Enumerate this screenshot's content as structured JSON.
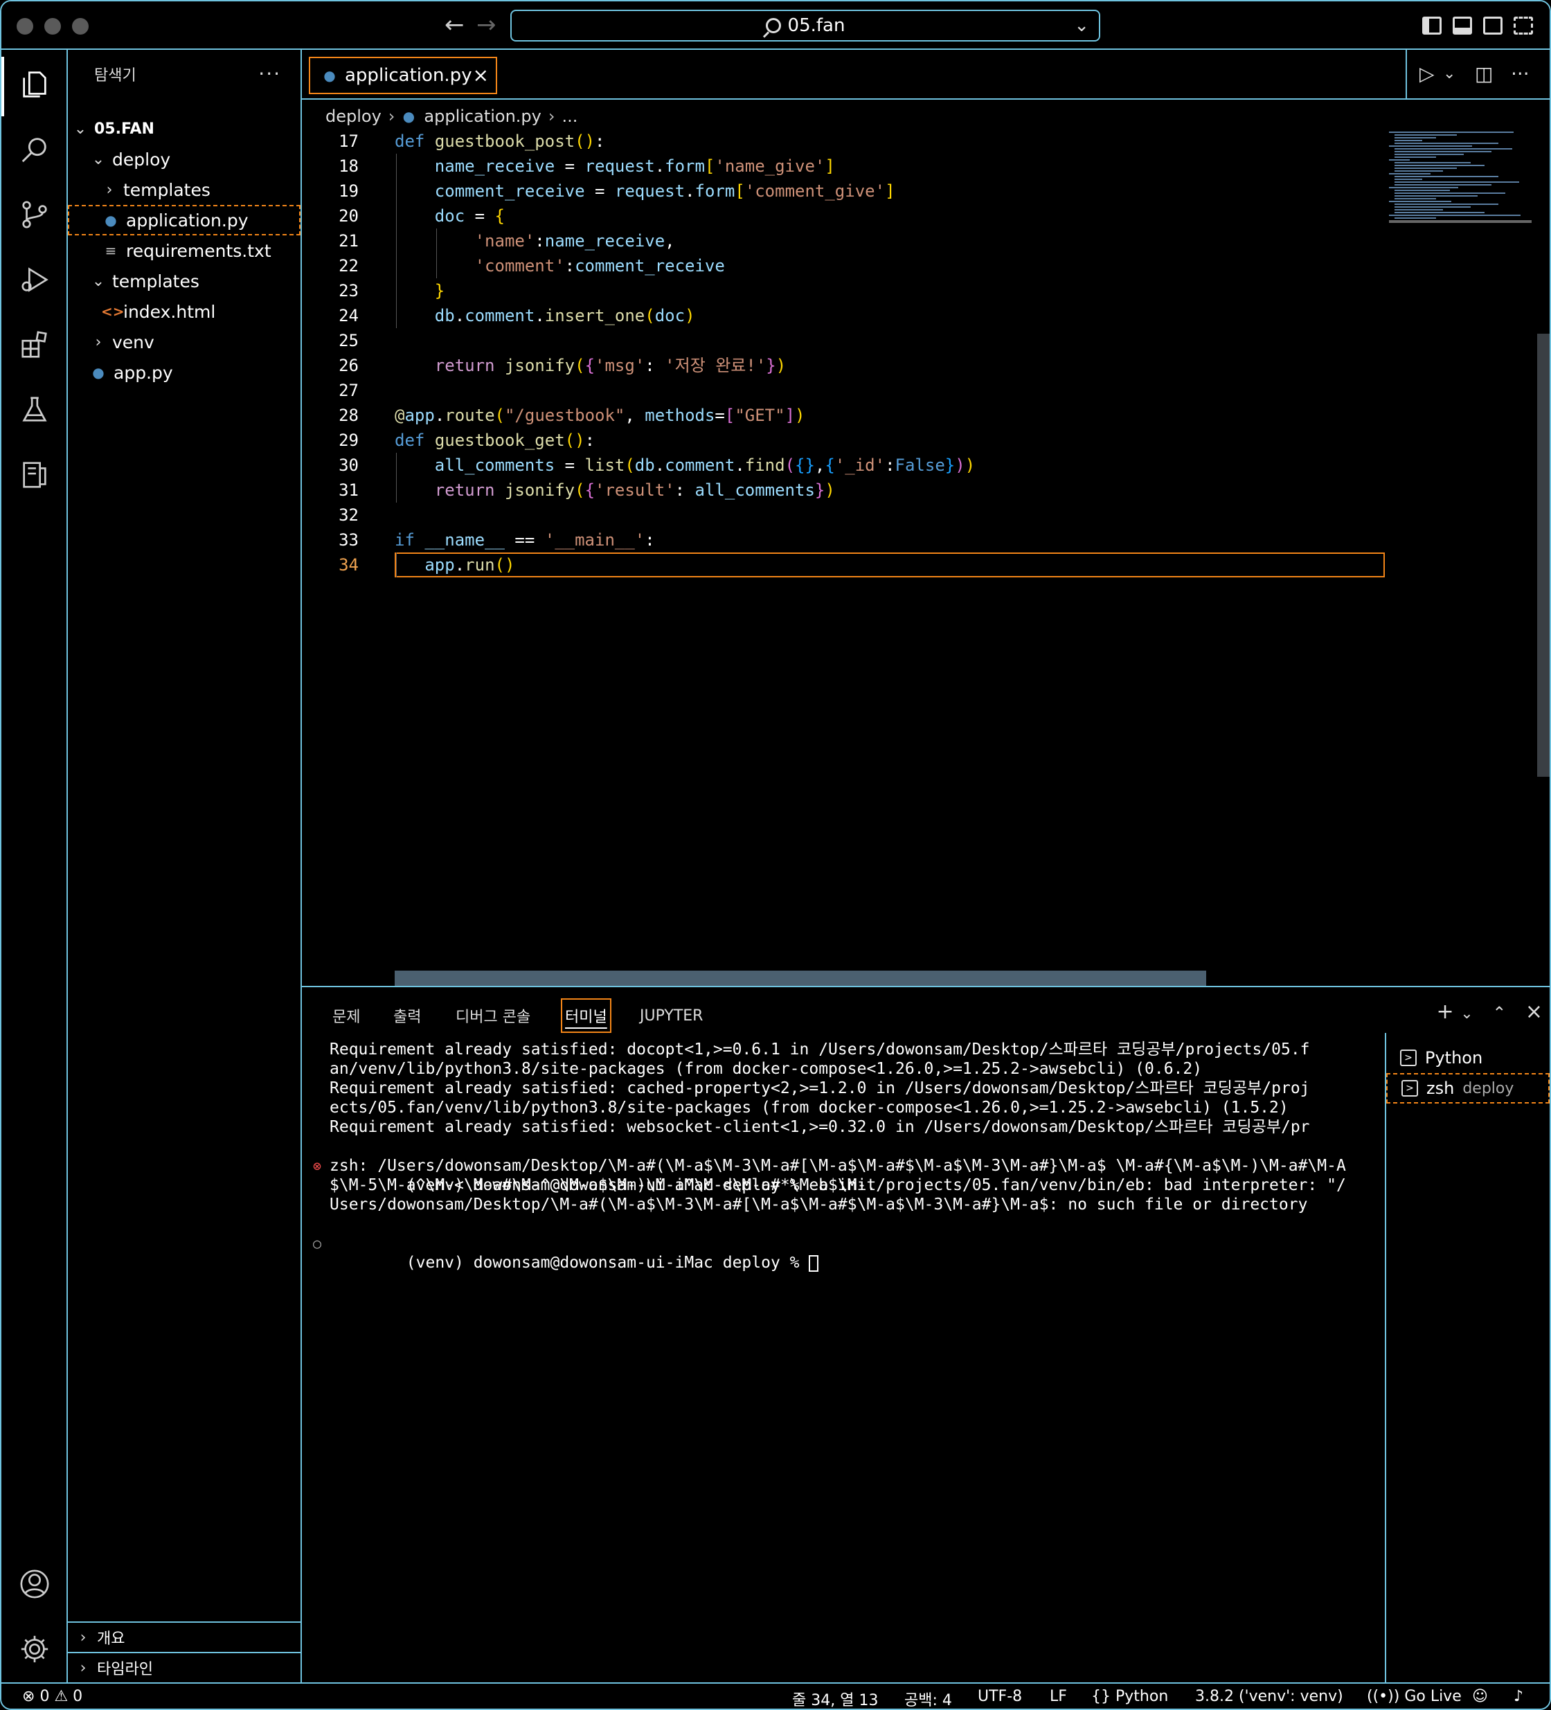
{
  "titlebar": {
    "search_text": "05.fan"
  },
  "sidebar": {
    "title": "탐색기",
    "root": "05.FAN",
    "tree": [
      {
        "label": "deploy",
        "kind": "folder-open"
      },
      {
        "label": "templates",
        "kind": "folder-closed"
      },
      {
        "label": "application.py",
        "kind": "python"
      },
      {
        "label": "requirements.txt",
        "kind": "text"
      },
      {
        "label": "templates",
        "kind": "folder-open"
      },
      {
        "label": "index.html",
        "kind": "html"
      },
      {
        "label": "venv",
        "kind": "folder-closed"
      },
      {
        "label": "app.py",
        "kind": "python"
      }
    ],
    "outline": "개요",
    "timeline": "타임라인"
  },
  "editor": {
    "tab_label": "application.py",
    "breadcrumb": {
      "folder": "deploy",
      "file": "application.py",
      "more": "..."
    },
    "current_line": "34",
    "lines": [
      {
        "n": "17",
        "text": "def guestbook_post():"
      },
      {
        "n": "18",
        "text": "    name_receive = request.form['name_give']"
      },
      {
        "n": "19",
        "text": "    comment_receive = request.form['comment_give']"
      },
      {
        "n": "20",
        "text": "    doc = {"
      },
      {
        "n": "21",
        "text": "        'name':name_receive,"
      },
      {
        "n": "22",
        "text": "        'comment':comment_receive"
      },
      {
        "n": "23",
        "text": "    }"
      },
      {
        "n": "24",
        "text": "    db.comment.insert_one(doc)"
      },
      {
        "n": "25",
        "text": ""
      },
      {
        "n": "26",
        "text": "    return jsonify({'msg': '저장 완료!'})"
      },
      {
        "n": "27",
        "text": ""
      },
      {
        "n": "28",
        "text": "@app.route(\"/guestbook\", methods=[\"GET\"])"
      },
      {
        "n": "29",
        "text": "def guestbook_get():"
      },
      {
        "n": "30",
        "text": "    all_comments = list(db.comment.find({},{'_id':False}))"
      },
      {
        "n": "31",
        "text": "    return jsonify({'result': all_comments})"
      },
      {
        "n": "32",
        "text": ""
      },
      {
        "n": "33",
        "text": "if __name__ == '__main__':"
      },
      {
        "n": "34",
        "text": "   app.run()"
      }
    ]
  },
  "panel": {
    "tabs": [
      "문제",
      "출력",
      "디버그 콘솔",
      "터미널",
      "JUPYTER"
    ],
    "active_tab": "터미널",
    "terminal_lines": [
      "Requirement already satisfied: docopt<1,>=0.6.1 in /Users/dowonsam/Desktop/스파르타 코딩공부/projects/05.f",
      "an/venv/lib/python3.8/site-packages (from docker-compose<1.26.0,>=1.25.2->awsebcli) (0.6.2)",
      "Requirement already satisfied: cached-property<2,>=1.2.0 in /Users/dowonsam/Desktop/스파르타 코딩공부/proj",
      "ects/05.fan/venv/lib/python3.8/site-packages (from docker-compose<1.26.0,>=1.25.2->awsebcli) (1.5.2)",
      "Requirement already satisfied: websocket-client<1,>=0.32.0 in /Users/dowonsam/Desktop/스파르타 코딩공부/pr",
      "(venv) dowonsam@dowonsam-ui-iMac deploy % eb init",
      "zsh: /Users/dowonsam/Desktop/\\M-a#(\\M-a$\\M-3\\M-a#[\\M-a$\\M-a#$\\M-a$\\M-3\\M-a#}\\M-a$ \\M-a#{\\M-a$\\M-)\\M-a#\\M-A",
      "$\\M-5\\M-a^\\M-<\\M-a#\\M-^@\\M-a$\\M-)\\M-a^\\M-<\\M-a#*\\M-a$\\M-./projects/05.fan/venv/bin/eb: bad interpreter: \"/",
      "Users/dowonsam/Desktop/\\M-a#(\\M-a$\\M-3\\M-a#[\\M-a$\\M-a#$\\M-a$\\M-3\\M-a#}\\M-a$: no such file or directory",
      "(venv) dowonsam@dowonsam-ui-iMac deploy % "
    ],
    "terminals": [
      {
        "name": "Python",
        "sub": ""
      },
      {
        "name": "zsh",
        "sub": "deploy"
      }
    ]
  },
  "statusbar": {
    "errors": "0",
    "warnings": "0",
    "position": "줄 34, 열 13",
    "spaces": "공백: 4",
    "encoding": "UTF-8",
    "eol": "LF",
    "language": "Python",
    "interpreter": "3.8.2 ('venv': venv)",
    "golive": "Go Live"
  },
  "colors": {
    "border": "#6fc3df",
    "focus": "#f38518",
    "keyword": "#569cd6",
    "string": "#ce9178"
  }
}
